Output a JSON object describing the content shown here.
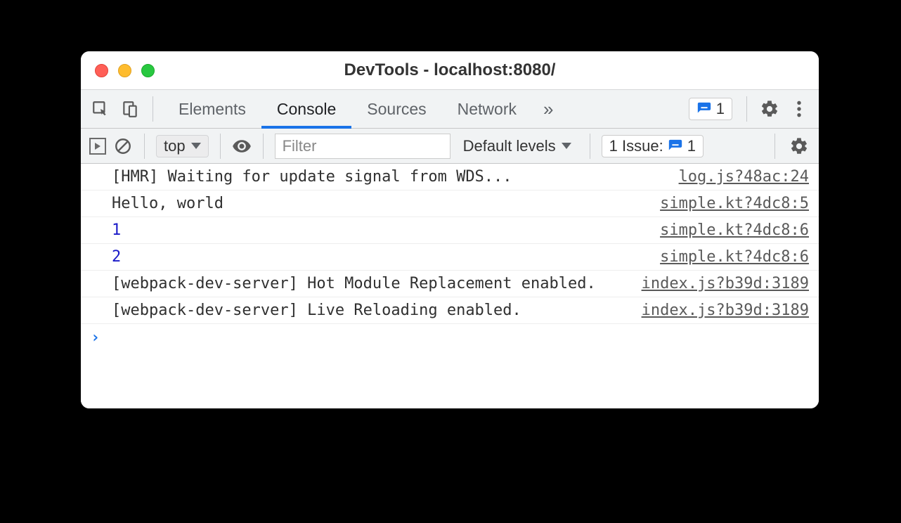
{
  "window": {
    "title": "DevTools - localhost:8080/"
  },
  "tabs": {
    "items": [
      {
        "label": "Elements",
        "active": false
      },
      {
        "label": "Console",
        "active": true
      },
      {
        "label": "Sources",
        "active": false
      },
      {
        "label": "Network",
        "active": false
      }
    ],
    "overflow_glyph": "»",
    "issues_badge_count": "1"
  },
  "toolbar": {
    "context": "top",
    "filter_placeholder": "Filter",
    "levels": "Default levels",
    "issues_label": "1 Issue:",
    "issues_count": "1"
  },
  "console": {
    "logs": [
      {
        "msg": "[HMR] Waiting for update signal from WDS...",
        "numeric": false,
        "src": "log.js?48ac:24"
      },
      {
        "msg": "Hello, world",
        "numeric": false,
        "src": "simple.kt?4dc8:5"
      },
      {
        "msg": "1",
        "numeric": true,
        "src": "simple.kt?4dc8:6"
      },
      {
        "msg": "2",
        "numeric": true,
        "src": "simple.kt?4dc8:6"
      },
      {
        "msg": "[webpack-dev-server] Hot Module Replacement enabled.",
        "numeric": false,
        "src": "index.js?b39d:3189"
      },
      {
        "msg": "[webpack-dev-server] Live Reloading enabled.",
        "numeric": false,
        "src": "index.js?b39d:3189"
      }
    ],
    "prompt_glyph": "›"
  }
}
